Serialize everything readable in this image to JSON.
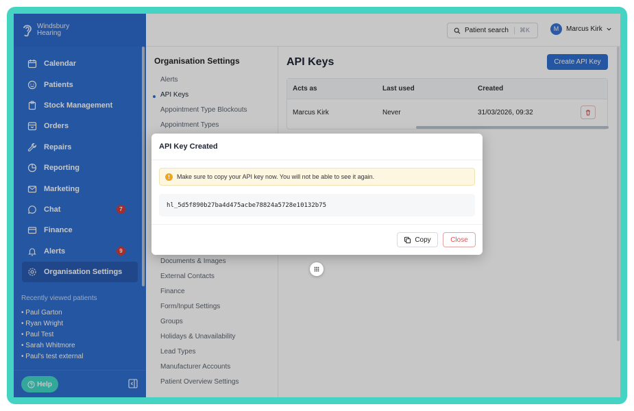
{
  "brand": {
    "name_line1": "Windsbury",
    "name_line2": "Hearing"
  },
  "sidebar": {
    "items": [
      {
        "label": "Calendar",
        "icon": "calendar-icon"
      },
      {
        "label": "Patients",
        "icon": "smile-icon"
      },
      {
        "label": "Stock Management",
        "icon": "clipboard-icon"
      },
      {
        "label": "Orders",
        "icon": "box-icon"
      },
      {
        "label": "Repairs",
        "icon": "wrench-icon"
      },
      {
        "label": "Reporting",
        "icon": "pie-chart-icon"
      },
      {
        "label": "Marketing",
        "icon": "mail-icon"
      },
      {
        "label": "Chat",
        "icon": "chat-icon",
        "badge": "7"
      },
      {
        "label": "Finance",
        "icon": "card-icon"
      },
      {
        "label": "Alerts",
        "icon": "bell-icon",
        "badge": "9"
      },
      {
        "label": "Organisation Settings",
        "icon": "gear-icon",
        "active": true
      }
    ],
    "recent_title": "Recently viewed patients",
    "recent": [
      "• Paul Garton",
      "• Ryan Wright",
      "• Paul Test",
      "• Sarah Whitmore",
      "• Paul's test external"
    ],
    "help_label": "Help"
  },
  "topbar": {
    "search_label": "Patient search",
    "search_shortcut": "⌘K",
    "user_initial": "M",
    "user_name": "Marcus Kirk"
  },
  "submenu": {
    "title": "Organisation Settings",
    "items_top": [
      "Alerts",
      "API Keys",
      "Appointment Type Blockouts",
      "Appointment Types"
    ],
    "items_bottom": [
      "Documents & Images",
      "External Contacts",
      "Finance",
      "Form/Input Settings",
      "Groups",
      "Holidays & Unavailability",
      "Lead Types",
      "Manufacturer Accounts",
      "Patient Overview Settings"
    ],
    "active": "API Keys"
  },
  "main": {
    "title": "API Keys",
    "create_label": "Create API Key",
    "columns": [
      "Acts as",
      "Last used",
      "Created"
    ],
    "rows": [
      {
        "acts_as": "Marcus Kirk",
        "last_used": "Never",
        "created": "31/03/2026, 09:32"
      }
    ]
  },
  "modal": {
    "title": "API Key Created",
    "warning": "Make sure to copy your API key now. You will not be able to see it again.",
    "key": "hl_5d5f890b27ba4d475acbe78824a5728e10132b75",
    "copy_label": "Copy",
    "close_label": "Close"
  },
  "colors": {
    "brand": "#2f6fcf",
    "frame": "#45d3c3",
    "danger": "#e05252",
    "help": "#42d7c4"
  }
}
